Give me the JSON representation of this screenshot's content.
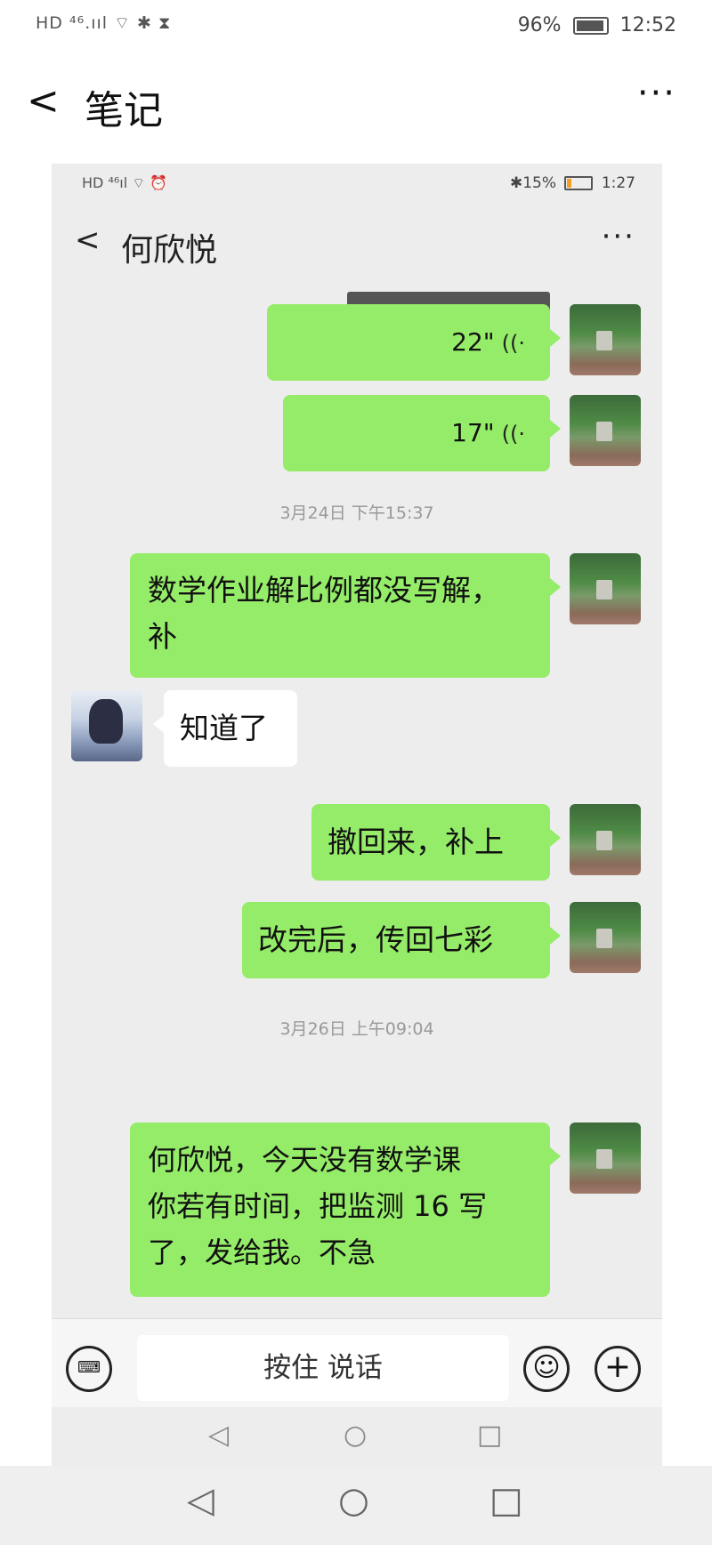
{
  "outer_status": {
    "left": "HD ⁴⁶.ııl ⌔ ✱ ⧗",
    "battery": "96%",
    "time": "12:52"
  },
  "outer_header": {
    "back": "<",
    "title": "笔记",
    "more": "···"
  },
  "inner_status": {
    "left": "HD ⁴⁶ıl ⌔ ⏰",
    "battery": "✱15%",
    "time": "1:27"
  },
  "chat_header": {
    "back": "<",
    "name": "何欣悦",
    "more": "···"
  },
  "messages": [
    {
      "side": "right",
      "type": "voice",
      "duration": "22\""
    },
    {
      "side": "right",
      "type": "voice",
      "duration": "17\""
    },
    {
      "type": "timestamp",
      "text": "3月24日 下午15:37"
    },
    {
      "side": "right",
      "type": "text",
      "lines": [
        "数学作业解比例都没写解，",
        "补"
      ]
    },
    {
      "side": "left",
      "type": "text",
      "lines": [
        "知道了"
      ]
    },
    {
      "side": "right",
      "type": "text",
      "lines": [
        "撤回来，补上"
      ]
    },
    {
      "side": "right",
      "type": "text",
      "lines": [
        "改完后，传回七彩"
      ]
    },
    {
      "type": "timestamp",
      "text": "3月26日 上午09:04"
    },
    {
      "side": "right",
      "type": "text",
      "lines": [
        "何欣悦，今天没有数学课",
        "你若有时间，把监测 16 写",
        "了，发给我。不急"
      ]
    }
  ],
  "input_bar": {
    "keyboard_icon": "⌨",
    "talk_label": "按住 说话",
    "emoji_icon": "☺",
    "plus_icon": "+"
  },
  "nav": {
    "back": "◁",
    "home": "○",
    "recents": "□"
  },
  "colors": {
    "sent_bubble": "#95ec69",
    "received_bubble": "#ffffff",
    "chat_bg": "#ededed"
  }
}
